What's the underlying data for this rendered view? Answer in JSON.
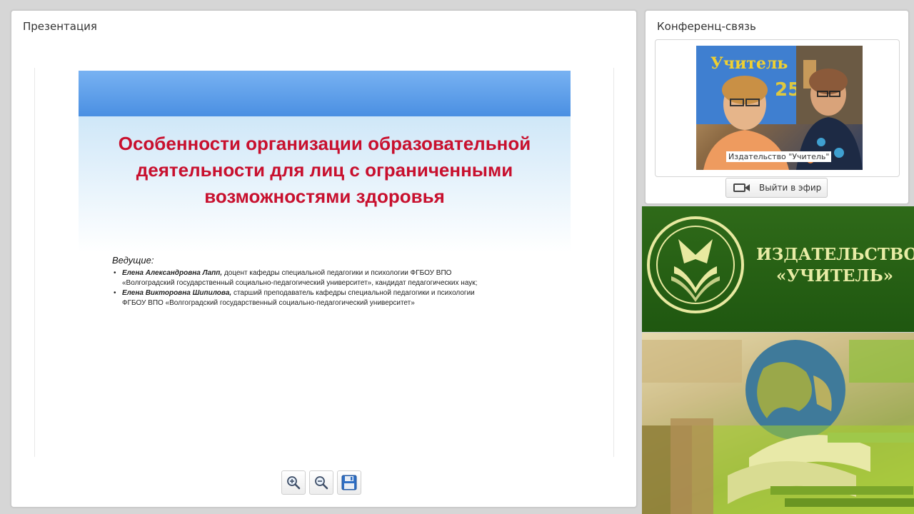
{
  "presentation": {
    "title": "Презентация",
    "slide": {
      "heading": "Особенности организации образовательной деятельности для лиц с ограниченными возможностями здоровья",
      "hosts_label": "Ведущие:",
      "hosts": [
        {
          "name": "Елена Александровна Лапп,",
          "line1": " доцент кафедры специальной педагогики и психологии ФГБОУ ВПО",
          "line2": "«Волгоградский государственный социально-педагогический университет», кандидат педагогических наук;"
        },
        {
          "name": "Елена Викторовна Шипилова,",
          "line1": " старший преподаватель кафедры специальной педагогики и психологии",
          "line2": "ФГБОУ ВПО «Волгоградский государственный социально-педагогический университет»"
        }
      ]
    },
    "toolbar": {
      "zoom_in_icon": "zoom-in-icon",
      "zoom_out_icon": "zoom-out-icon",
      "save_icon": "floppy-disk-icon"
    }
  },
  "conference": {
    "title": "Конференц-связь",
    "video_caption": "Издательство \"Учитель\"",
    "broadcast_label": "Выйти в эфир",
    "broadcast_icon": "video-camera-icon"
  },
  "banner": {
    "line1": "ИЗДАТЕЛЬСТВО",
    "line2": "«УЧИТЕЛЬ»"
  },
  "colors": {
    "slide_heading": "#c8102e",
    "banner_bg": "#2f6a19",
    "banner_text": "#e8eca5",
    "slide_top_bar": "#4a8fe2"
  }
}
